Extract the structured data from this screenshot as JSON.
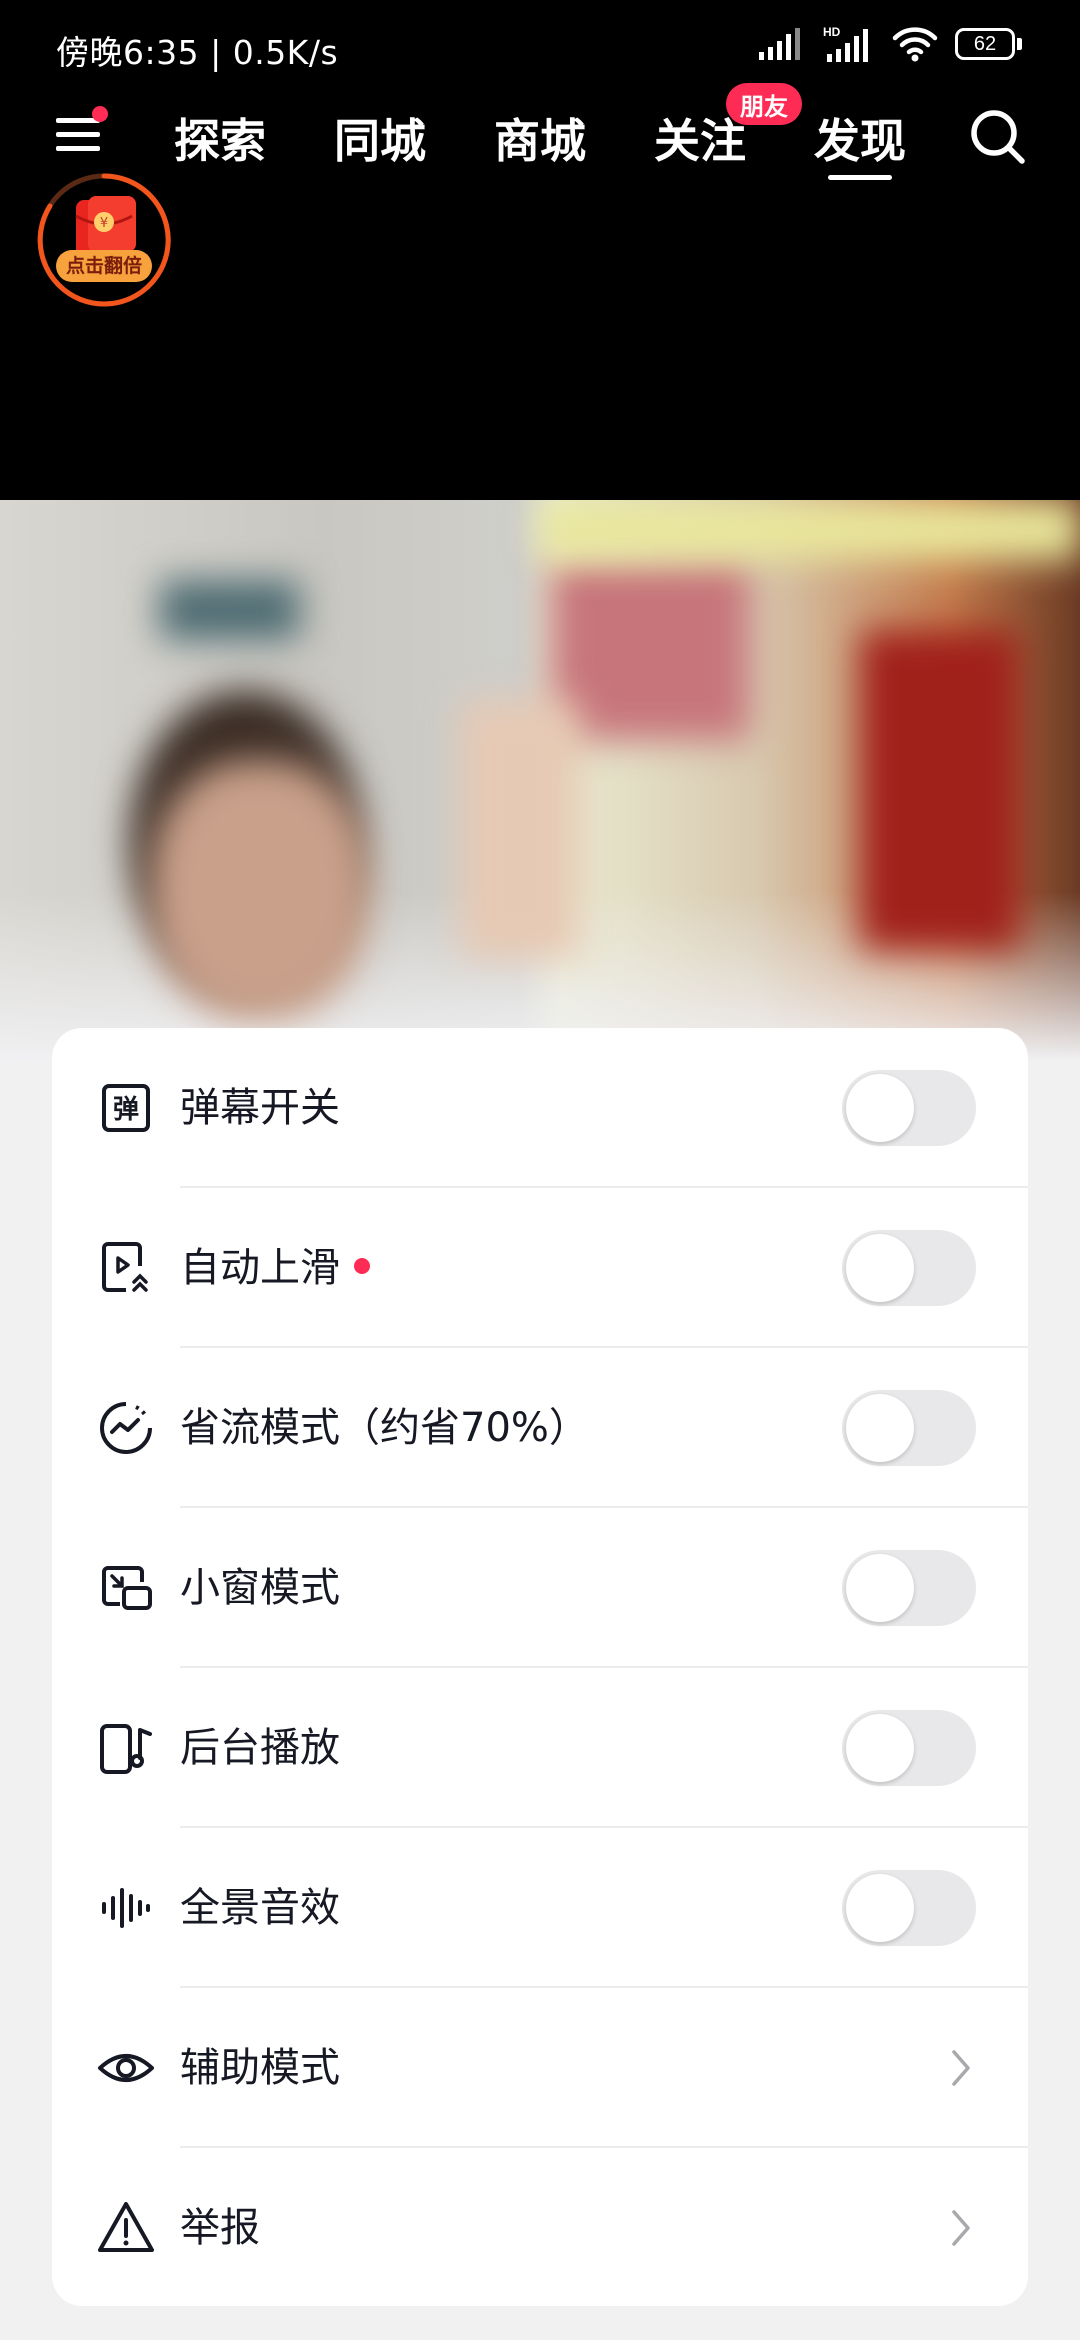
{
  "status_bar": {
    "time_speed": "傍晚6:35 | 0.5K/s",
    "battery_level": "62"
  },
  "nav": {
    "tabs": [
      {
        "label": "探索"
      },
      {
        "label": "同城"
      },
      {
        "label": "商城"
      },
      {
        "label": "关注",
        "badge": "朋友"
      },
      {
        "label": "发现",
        "active": true
      }
    ]
  },
  "redpacket": {
    "label": "点击翻倍",
    "symbol": "¥"
  },
  "settings": {
    "items": [
      {
        "label": "弹幕开关",
        "icon": "danmaku-icon",
        "control": "toggle",
        "on": false,
        "icon_char": "弹"
      },
      {
        "label": "自动上滑",
        "icon": "auto-scroll-icon",
        "control": "toggle",
        "on": false,
        "dot": true
      },
      {
        "label": "省流模式（约省70%）",
        "icon": "data-saver-icon",
        "control": "toggle",
        "on": false
      },
      {
        "label": "小窗模式",
        "icon": "pip-icon",
        "control": "toggle",
        "on": false
      },
      {
        "label": "后台播放",
        "icon": "background-play-icon",
        "control": "toggle",
        "on": false
      },
      {
        "label": "全景音效",
        "icon": "spatial-audio-icon",
        "control": "toggle",
        "on": false
      },
      {
        "label": "辅助模式",
        "icon": "eye-icon",
        "control": "chevron"
      },
      {
        "label": "举报",
        "icon": "warning-icon",
        "control": "chevron"
      }
    ]
  },
  "colors": {
    "accent": "#fe2c55",
    "toggle_off": "#e8e8ea",
    "text_primary": "#161823"
  }
}
